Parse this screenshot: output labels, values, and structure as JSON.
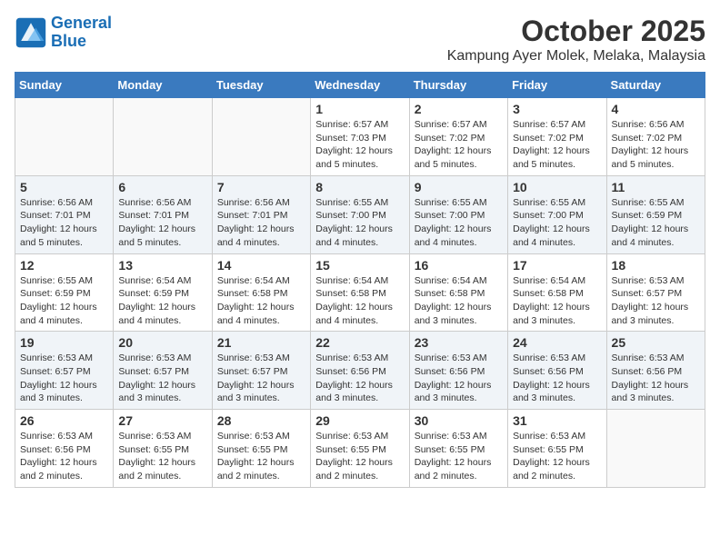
{
  "header": {
    "logo_line1": "General",
    "logo_line2": "Blue",
    "month": "October 2025",
    "location": "Kampung Ayer Molek, Melaka, Malaysia"
  },
  "days_of_week": [
    "Sunday",
    "Monday",
    "Tuesday",
    "Wednesday",
    "Thursday",
    "Friday",
    "Saturday"
  ],
  "weeks": [
    [
      {
        "day": "",
        "info": ""
      },
      {
        "day": "",
        "info": ""
      },
      {
        "day": "",
        "info": ""
      },
      {
        "day": "1",
        "info": "Sunrise: 6:57 AM\nSunset: 7:03 PM\nDaylight: 12 hours\nand 5 minutes."
      },
      {
        "day": "2",
        "info": "Sunrise: 6:57 AM\nSunset: 7:02 PM\nDaylight: 12 hours\nand 5 minutes."
      },
      {
        "day": "3",
        "info": "Sunrise: 6:57 AM\nSunset: 7:02 PM\nDaylight: 12 hours\nand 5 minutes."
      },
      {
        "day": "4",
        "info": "Sunrise: 6:56 AM\nSunset: 7:02 PM\nDaylight: 12 hours\nand 5 minutes."
      }
    ],
    [
      {
        "day": "5",
        "info": "Sunrise: 6:56 AM\nSunset: 7:01 PM\nDaylight: 12 hours\nand 5 minutes."
      },
      {
        "day": "6",
        "info": "Sunrise: 6:56 AM\nSunset: 7:01 PM\nDaylight: 12 hours\nand 5 minutes."
      },
      {
        "day": "7",
        "info": "Sunrise: 6:56 AM\nSunset: 7:01 PM\nDaylight: 12 hours\nand 4 minutes."
      },
      {
        "day": "8",
        "info": "Sunrise: 6:55 AM\nSunset: 7:00 PM\nDaylight: 12 hours\nand 4 minutes."
      },
      {
        "day": "9",
        "info": "Sunrise: 6:55 AM\nSunset: 7:00 PM\nDaylight: 12 hours\nand 4 minutes."
      },
      {
        "day": "10",
        "info": "Sunrise: 6:55 AM\nSunset: 7:00 PM\nDaylight: 12 hours\nand 4 minutes."
      },
      {
        "day": "11",
        "info": "Sunrise: 6:55 AM\nSunset: 6:59 PM\nDaylight: 12 hours\nand 4 minutes."
      }
    ],
    [
      {
        "day": "12",
        "info": "Sunrise: 6:55 AM\nSunset: 6:59 PM\nDaylight: 12 hours\nand 4 minutes."
      },
      {
        "day": "13",
        "info": "Sunrise: 6:54 AM\nSunset: 6:59 PM\nDaylight: 12 hours\nand 4 minutes."
      },
      {
        "day": "14",
        "info": "Sunrise: 6:54 AM\nSunset: 6:58 PM\nDaylight: 12 hours\nand 4 minutes."
      },
      {
        "day": "15",
        "info": "Sunrise: 6:54 AM\nSunset: 6:58 PM\nDaylight: 12 hours\nand 4 minutes."
      },
      {
        "day": "16",
        "info": "Sunrise: 6:54 AM\nSunset: 6:58 PM\nDaylight: 12 hours\nand 3 minutes."
      },
      {
        "day": "17",
        "info": "Sunrise: 6:54 AM\nSunset: 6:58 PM\nDaylight: 12 hours\nand 3 minutes."
      },
      {
        "day": "18",
        "info": "Sunrise: 6:53 AM\nSunset: 6:57 PM\nDaylight: 12 hours\nand 3 minutes."
      }
    ],
    [
      {
        "day": "19",
        "info": "Sunrise: 6:53 AM\nSunset: 6:57 PM\nDaylight: 12 hours\nand 3 minutes."
      },
      {
        "day": "20",
        "info": "Sunrise: 6:53 AM\nSunset: 6:57 PM\nDaylight: 12 hours\nand 3 minutes."
      },
      {
        "day": "21",
        "info": "Sunrise: 6:53 AM\nSunset: 6:57 PM\nDaylight: 12 hours\nand 3 minutes."
      },
      {
        "day": "22",
        "info": "Sunrise: 6:53 AM\nSunset: 6:56 PM\nDaylight: 12 hours\nand 3 minutes."
      },
      {
        "day": "23",
        "info": "Sunrise: 6:53 AM\nSunset: 6:56 PM\nDaylight: 12 hours\nand 3 minutes."
      },
      {
        "day": "24",
        "info": "Sunrise: 6:53 AM\nSunset: 6:56 PM\nDaylight: 12 hours\nand 3 minutes."
      },
      {
        "day": "25",
        "info": "Sunrise: 6:53 AM\nSunset: 6:56 PM\nDaylight: 12 hours\nand 3 minutes."
      }
    ],
    [
      {
        "day": "26",
        "info": "Sunrise: 6:53 AM\nSunset: 6:56 PM\nDaylight: 12 hours\nand 2 minutes."
      },
      {
        "day": "27",
        "info": "Sunrise: 6:53 AM\nSunset: 6:55 PM\nDaylight: 12 hours\nand 2 minutes."
      },
      {
        "day": "28",
        "info": "Sunrise: 6:53 AM\nSunset: 6:55 PM\nDaylight: 12 hours\nand 2 minutes."
      },
      {
        "day": "29",
        "info": "Sunrise: 6:53 AM\nSunset: 6:55 PM\nDaylight: 12 hours\nand 2 minutes."
      },
      {
        "day": "30",
        "info": "Sunrise: 6:53 AM\nSunset: 6:55 PM\nDaylight: 12 hours\nand 2 minutes."
      },
      {
        "day": "31",
        "info": "Sunrise: 6:53 AM\nSunset: 6:55 PM\nDaylight: 12 hours\nand 2 minutes."
      },
      {
        "day": "",
        "info": ""
      }
    ]
  ]
}
